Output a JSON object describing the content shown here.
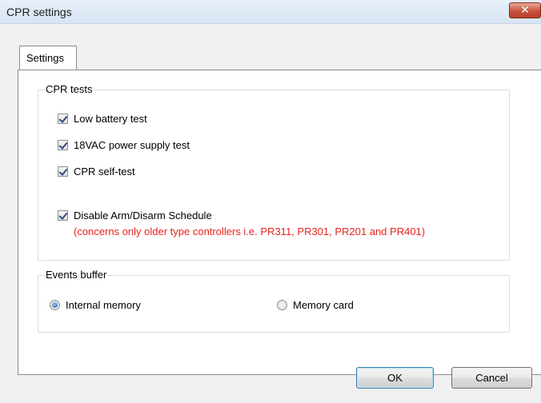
{
  "window": {
    "title": "CPR settings",
    "close_glyph": "✕"
  },
  "tabs": [
    {
      "label": "Settings"
    }
  ],
  "cpr_tests": {
    "title": "CPR tests",
    "items": [
      {
        "label": "Low battery test",
        "checked": true
      },
      {
        "label": "18VAC power supply test",
        "checked": true
      },
      {
        "label": "CPR self-test",
        "checked": true
      },
      {
        "label": "Disable Arm/Disarm Schedule",
        "checked": true
      }
    ],
    "note": "(concerns only older type controllers i.e. PR311, PR301, PR201 and PR401)",
    "note_color": "#e8231d"
  },
  "events_buffer": {
    "title": "Events buffer",
    "options": [
      {
        "label": "Internal memory",
        "selected": true
      },
      {
        "label": "Memory card",
        "selected": false
      }
    ]
  },
  "buttons": {
    "ok": "OK",
    "cancel": "Cancel"
  }
}
